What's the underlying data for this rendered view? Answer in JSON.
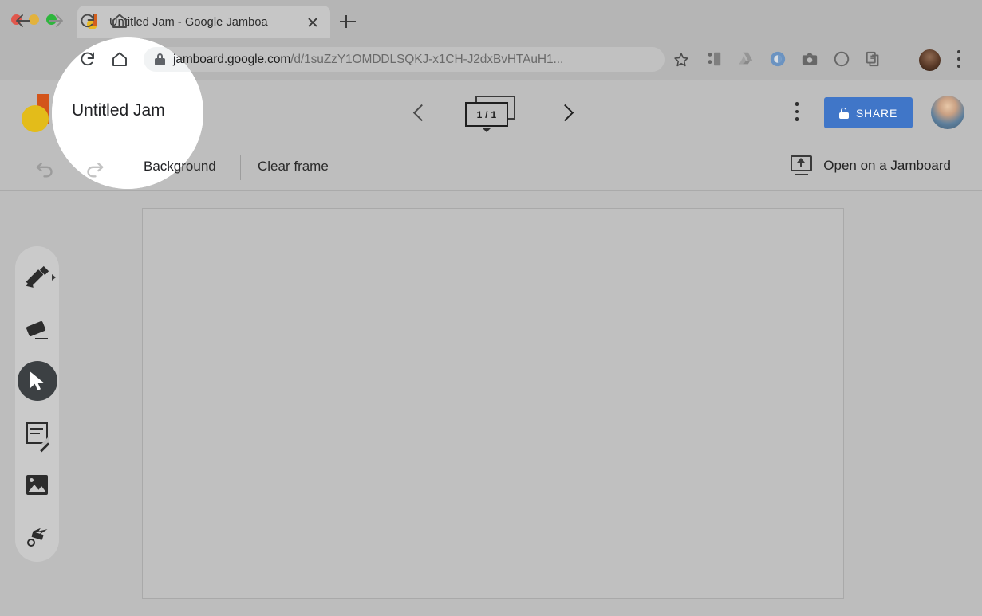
{
  "browser": {
    "window_controls": [
      "close",
      "minimize",
      "maximize"
    ],
    "tab": {
      "title": "Untitled Jam - Google Jamboa",
      "favicon_name": "jamboard-favicon",
      "close_label": "Close tab"
    },
    "new_tab_label": "New Tab",
    "nav": {
      "back_label": "Back",
      "forward_label": "Forward",
      "reload_label": "Reload",
      "home_label": "Home"
    },
    "omnibox": {
      "lock_icon": "lock-icon",
      "url_host": "jamboard.google.com",
      "url_path": "/d/1suZzY1OMDDLSQKJ-x1CH-J2dxBvHTAuH1...",
      "bookmark_icon": "star-icon"
    },
    "extensions": [
      "contacts-extension-icon",
      "google-drive-icon",
      "browser-extension-icon",
      "screenshot-camera-icon",
      "circle-extension-icon",
      "copy-documents-icon"
    ],
    "profile_avatar": "browser-profile-avatar",
    "menu_icon": "browser-kebab-menu-icon"
  },
  "jamboard": {
    "logo_name": "jamboard-logo",
    "title": "Untitled Jam",
    "frame_nav": {
      "prev_label": "Previous frame",
      "next_label": "Next frame",
      "counter": "1 / 1",
      "expand_label": "Expand frame bar"
    },
    "more_menu_label": "More actions",
    "share": {
      "label": "SHARE",
      "lock_icon": "lock-icon",
      "accent_color": "#4076c8"
    },
    "account_avatar": "jamboard-account-avatar",
    "toolbar": {
      "undo_label": "Undo",
      "redo_label": "Redo",
      "background_label": "Background",
      "clear_frame_label": "Clear frame",
      "open_on_jamboard_label": "Open on a Jamboard",
      "cast_icon": "present-to-board-icon"
    },
    "tools": [
      {
        "id": "pen",
        "name": "pen-tool",
        "label": "Pen",
        "active": false,
        "has_submenu": true
      },
      {
        "id": "eraser",
        "name": "eraser-tool",
        "label": "Eraser",
        "active": false,
        "has_submenu": false
      },
      {
        "id": "select",
        "name": "select-tool",
        "label": "Select",
        "active": true,
        "has_submenu": false
      },
      {
        "id": "note",
        "name": "sticky-note-tool",
        "label": "Sticky note",
        "active": false,
        "has_submenu": false
      },
      {
        "id": "image",
        "name": "add-image-tool",
        "label": "Add image",
        "active": false,
        "has_submenu": false
      },
      {
        "id": "laser",
        "name": "laser-pointer-tool",
        "label": "Laser pointer",
        "active": false,
        "has_submenu": false
      }
    ],
    "canvas_label": "Jam frame canvas"
  },
  "overlay": {
    "spotlight_name": "spotlight-highlight",
    "target": "Untitled Jam"
  },
  "colors": {
    "page_background": "#bdbdbd",
    "chrome_background": "#b5b5b5",
    "share_blue": "#4076c8",
    "logo_yellow": "#e3bc1a",
    "logo_orange": "#d3541a",
    "active_tool": "#3c4043"
  }
}
